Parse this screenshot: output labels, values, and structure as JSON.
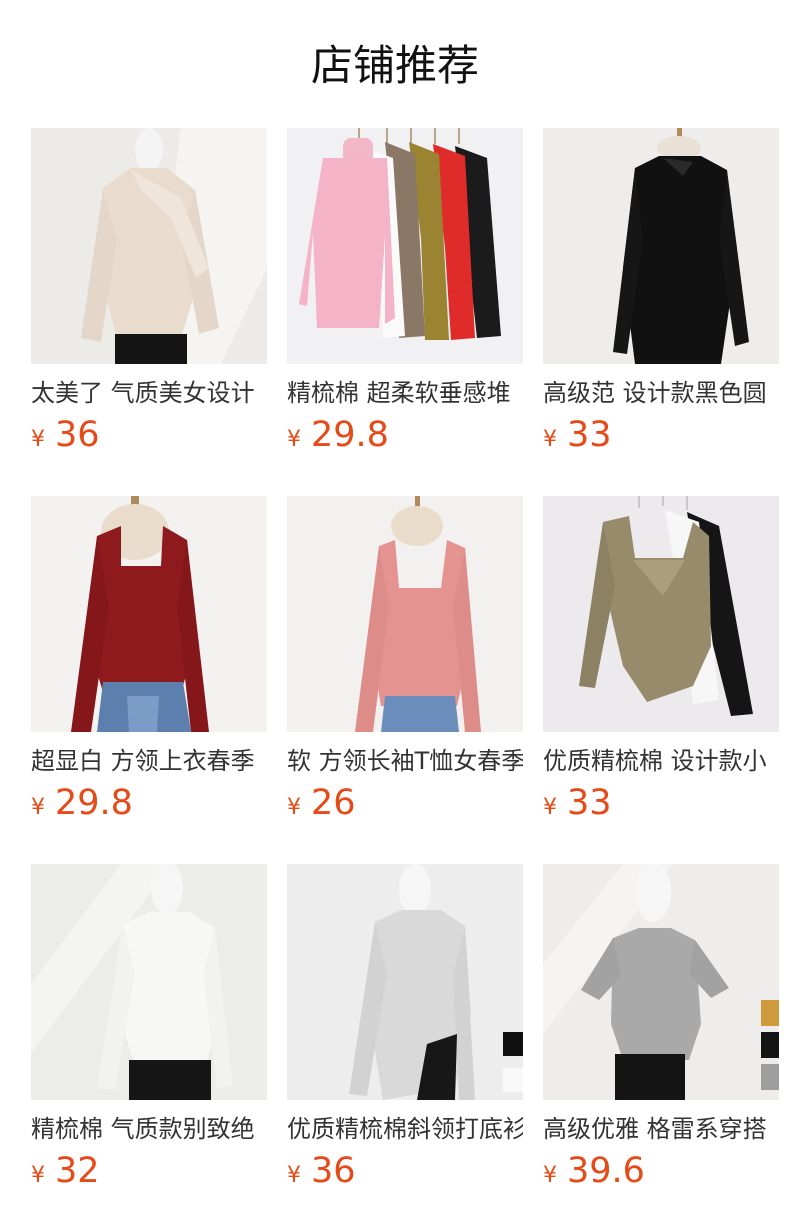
{
  "header": {
    "title": "店铺推荐"
  },
  "colors": {
    "price": "#e64a19",
    "text": "#333333",
    "title": "#111111"
  },
  "products": [
    {
      "name": "太美了 气质美女设计",
      "currency": "¥",
      "price": "36",
      "image": "beige-tie-neck-top"
    },
    {
      "name": "精梳棉 超柔软垂感堆",
      "currency": "¥",
      "price": "29.8",
      "image": "turtleneck-colors-hanger"
    },
    {
      "name": "高级范 设计款黑色圆",
      "currency": "¥",
      "price": "33",
      "image": "black-ruched-top"
    },
    {
      "name": "超显白 方领上衣春季",
      "currency": "¥",
      "price": "29.8",
      "image": "red-square-neck-top"
    },
    {
      "name": "软 方领长袖T恤女春季",
      "currency": "¥",
      "price": "26",
      "image": "pink-square-neck-top"
    },
    {
      "name": "优质精梳棉 设计款小",
      "currency": "¥",
      "price": "33",
      "image": "khaki-square-neck-hanger"
    },
    {
      "name": "精梳棉 气质款别致绝",
      "currency": "¥",
      "price": "32",
      "image": "white-drape-top"
    },
    {
      "name": "优质精梳棉斜领打底衫",
      "currency": "¥",
      "price": "36",
      "image": "grey-asymmetric-top"
    },
    {
      "name": "高级优雅 格雷系穿搭",
      "currency": "¥",
      "price": "39.6",
      "image": "grey-knit-short-sleeve"
    }
  ]
}
